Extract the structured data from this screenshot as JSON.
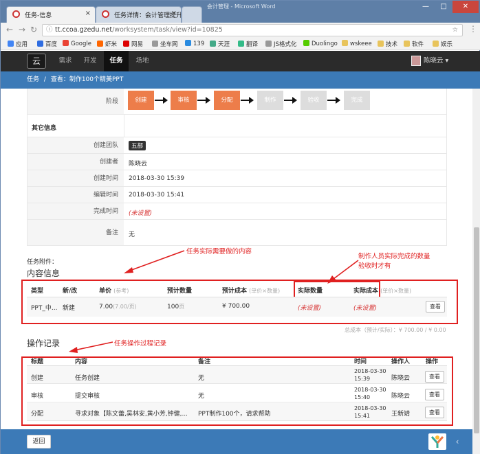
{
  "browser": {
    "tabs": [
      {
        "title": "任务-信息",
        "active": true
      },
      {
        "title": "任务详情：会计管理提升",
        "active": false
      }
    ],
    "url_prefix": "tt.ccoa.gzedu.net",
    "url_path": "/worksystem/task/view?id=10825",
    "window_caption": "会计管理 - Microsoft Word",
    "bookmarks": [
      "应用",
      "百度",
      "Google",
      "虾米",
      "网易",
      "坐车网",
      "139",
      "天涯",
      "翻译",
      "JS格式化",
      "Duolingo",
      "wskeee",
      "技术",
      "软件",
      "娱乐"
    ]
  },
  "nav": {
    "items": [
      "需求",
      "开发",
      "任务",
      "场地"
    ],
    "active": "任务",
    "user": "陈晓云"
  },
  "breadcrumb": {
    "root": "任务",
    "separator": "/",
    "current": "查看：制作100个精美PPT"
  },
  "stage": {
    "label": "阶段",
    "steps": [
      {
        "name": "创建",
        "done": true
      },
      {
        "name": "审核",
        "done": true
      },
      {
        "name": "分配",
        "done": true
      },
      {
        "name": "制作",
        "done": false
      },
      {
        "name": "验收",
        "done": false
      },
      {
        "name": "完成",
        "done": false
      }
    ]
  },
  "other_info": {
    "title": "其它信息",
    "rows": [
      {
        "label": "创建团队",
        "value": "五部"
      },
      {
        "label": "创建者",
        "value": "陈晓云"
      },
      {
        "label": "创建时间",
        "value": "2018-03-30 15:39"
      },
      {
        "label": "编辑时间",
        "value": "2018-03-30 15:41"
      },
      {
        "label": "完成时间",
        "value": "(未设置)"
      },
      {
        "label": "备注",
        "value": "无"
      }
    ]
  },
  "attachments_label": "任务附件：",
  "content_info": {
    "title": "内容信息",
    "headers": {
      "type": "类型",
      "new_edit": "新/改",
      "price": "单价",
      "price_hint": "(参考)",
      "est_qty": "预计数量",
      "est_cost": "预计成本",
      "est_cost_hint": "(单价×数量)",
      "act_qty": "实际数量",
      "act_cost": "实际成本",
      "act_cost_hint": "(单价×数量)"
    },
    "row": {
      "type": "PPT_中...",
      "new_edit": "新建",
      "price": "7.00",
      "price_sub": "(7.00/页)",
      "est_qty": "100",
      "est_qty_unit": "页",
      "est_cost": "¥ 700.00",
      "act_qty": "(未设置)",
      "act_cost": "(未设置)",
      "action": "查看"
    },
    "total": "总成本（预计/实际）：¥ 700.00 / ¥ 0.00"
  },
  "annotations": {
    "content": "任务实际需要做的内容",
    "actual_line1": "制作人员实际完成的数量",
    "actual_line2": "验收时才有",
    "log": "任务操作过程记录"
  },
  "log": {
    "title": "操作记录",
    "headers": [
      "标题",
      "内容",
      "备注",
      "时间",
      "操作人",
      "操作"
    ],
    "rows": [
      {
        "title": "创建",
        "content": "任务创建",
        "note": "无",
        "date": "2018-03-30",
        "time": "15:39",
        "user": "陈晓云",
        "action": "查看"
      },
      {
        "title": "审核",
        "content": "提交审核",
        "note": "无",
        "date": "2018-03-30",
        "time": "15:40",
        "user": "陈晓云",
        "action": "查看"
      },
      {
        "title": "分配",
        "content": "寻求对象【陈文蕾,吴林安,黄小芳,钟健,...",
        "note": "PPT制作100个，请求帮助",
        "date": "2018-03-30",
        "time": "15:41",
        "user": "王新靖",
        "action": "查看"
      }
    ]
  },
  "footer": {
    "back": "返回"
  }
}
